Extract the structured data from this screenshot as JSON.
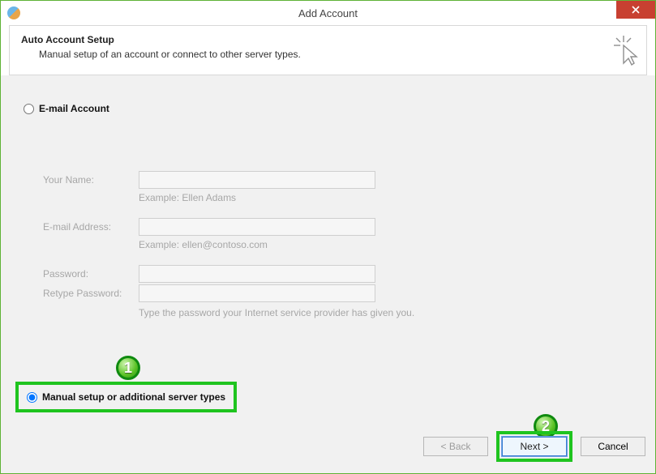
{
  "titlebar": {
    "title": "Add Account"
  },
  "header": {
    "title": "Auto Account Setup",
    "subtitle": "Manual setup of an account or connect to other server types."
  },
  "radios": {
    "email_label": "E-mail Account",
    "manual_label": "Manual setup or additional server types"
  },
  "form": {
    "name_label": "Your Name:",
    "name_hint": "Example: Ellen Adams",
    "email_label": "E-mail Address:",
    "email_hint": "Example: ellen@contoso.com",
    "password_label": "Password:",
    "retype_label": "Retype Password:",
    "password_hint": "Type the password your Internet service provider has given you."
  },
  "buttons": {
    "back": "< Back",
    "next": "Next >",
    "cancel": "Cancel"
  },
  "annotations": {
    "badge1": "1",
    "badge2": "2"
  }
}
